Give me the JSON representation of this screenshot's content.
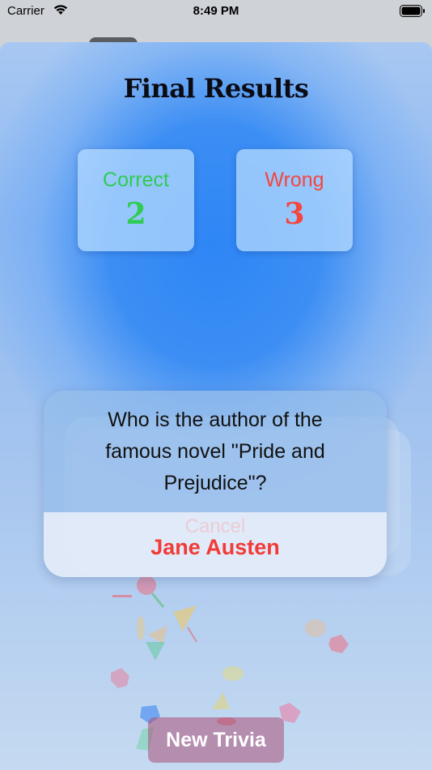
{
  "status_bar": {
    "carrier": "Carrier",
    "time": "8:49 PM"
  },
  "results": {
    "title": "Final Results",
    "correct_label": "Correct",
    "correct_count": "2",
    "wrong_label": "Wrong",
    "wrong_count": "3"
  },
  "question_card": {
    "question": "Who is the author of the famous novel \"Pride and Prejudice\"?",
    "ghost_button": "Cancel",
    "answer": "Jane Austen"
  },
  "footer": {
    "new_trivia_label": "New Trivia"
  },
  "colors": {
    "correct": "#2ecc52",
    "wrong": "#f5453e",
    "accent": "#2e86f5"
  },
  "icons": [
    "wifi-icon",
    "battery-icon"
  ]
}
